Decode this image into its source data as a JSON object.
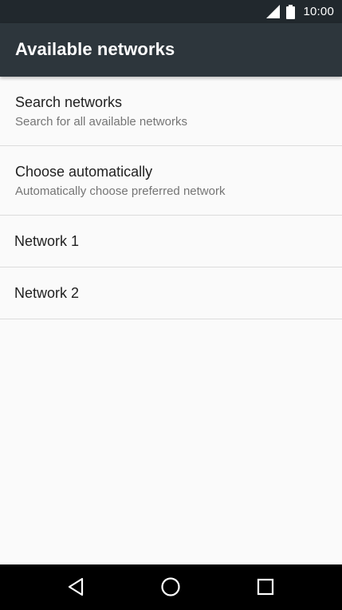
{
  "status_bar": {
    "time": "10:00",
    "icons": [
      "cell-signal-icon",
      "battery-icon"
    ]
  },
  "app_bar": {
    "title": "Available networks"
  },
  "list": {
    "items": [
      {
        "primary": "Search networks",
        "secondary": "Search for all available networks"
      },
      {
        "primary": "Choose automatically",
        "secondary": "Automatically choose preferred network"
      },
      {
        "primary": "Network 1"
      },
      {
        "primary": "Network 2"
      }
    ]
  },
  "nav_bar": {
    "icons": [
      "back-icon",
      "home-icon",
      "recents-icon"
    ]
  },
  "colors": {
    "status_bar": "#21282d",
    "app_bar": "#2d363c",
    "background": "#fafafa",
    "divider": "#dcdcdc",
    "nav_bar": "#000000"
  }
}
